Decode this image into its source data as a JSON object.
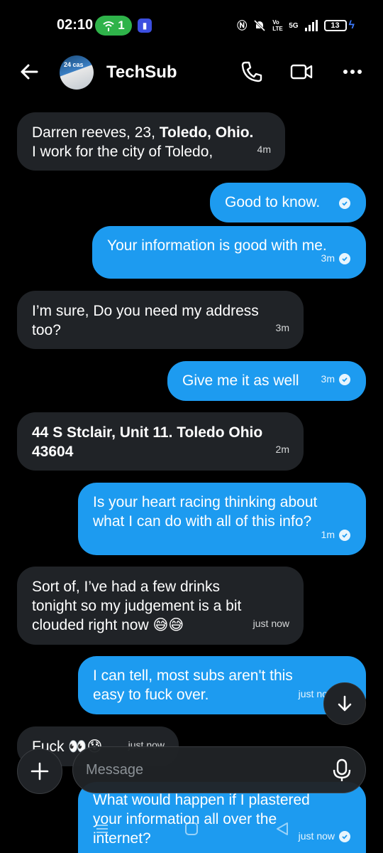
{
  "status_bar": {
    "time": "02:10",
    "hotspot_count": "1",
    "network": "5G",
    "volte": "Vo LTE",
    "battery": "13"
  },
  "header": {
    "contact_name": "TechSub",
    "avatar_sign_text": "24 cas"
  },
  "messages": [
    {
      "from": "them",
      "line1_pre": "Darren reeves, 23, ",
      "line1_bold": "Toledo, Ohio.",
      "line2": "I work for the city of Toledo,",
      "time": "4m"
    },
    {
      "from": "me",
      "text": "Good to know.",
      "time": ""
    },
    {
      "from": "me",
      "text": "Your information is good with me.",
      "time": "3m"
    },
    {
      "from": "them",
      "line1": "I’m sure, Do you need my address",
      "line2": "too?",
      "time": "3m"
    },
    {
      "from": "me",
      "text": "Give me it as well",
      "time": "3m"
    },
    {
      "from": "them",
      "line1": "44 S Stclair, Unit 11. Toledo Ohio",
      "line2": "43604",
      "time": "2m"
    },
    {
      "from": "me",
      "line1": "Is your heart racing thinking about",
      "line2": "what I can do with all of this info?",
      "time": "1m"
    },
    {
      "from": "them",
      "line1": "Sort of, I’ve had a few drinks",
      "line2": "tonight so my judgement is a bit",
      "line3": "clouded right now 😅😅",
      "time": "just now"
    },
    {
      "from": "me",
      "line1": "I can tell, most subs aren't this",
      "line2": "easy to fuck over.",
      "time": "just now"
    },
    {
      "from": "them",
      "text": "Fuck 👀😰",
      "time": "just now"
    },
    {
      "from": "me",
      "line1": "What would happen if I plastered",
      "line2": "your information all over the",
      "line3": "internet?",
      "time": "just now"
    }
  ],
  "composer": {
    "placeholder": "Message"
  },
  "colors": {
    "outgoing_bubble": "#1d9bf0",
    "incoming_bubble": "#202327",
    "background": "#000000",
    "hotspot_pill": "#2fb34a"
  }
}
